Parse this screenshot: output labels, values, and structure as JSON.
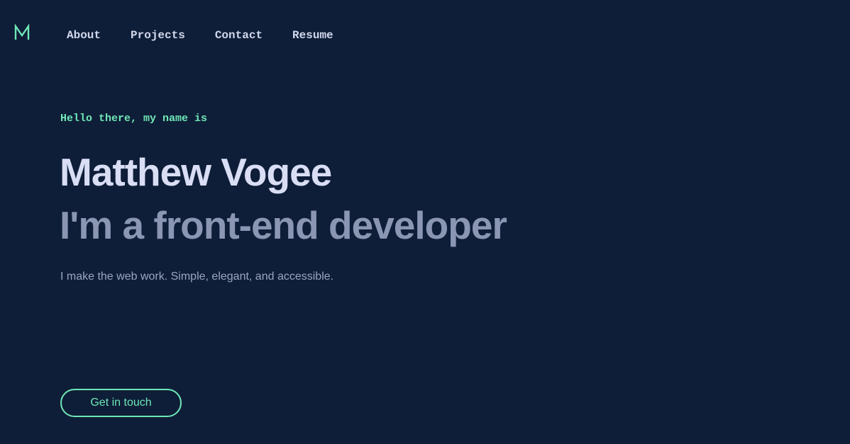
{
  "logo": {
    "icon": "m-logo-icon",
    "color": "#6ee7b7"
  },
  "nav": {
    "items": [
      {
        "label": "About"
      },
      {
        "label": "Projects"
      },
      {
        "label": "Contact"
      },
      {
        "label": "Resume"
      }
    ]
  },
  "hero": {
    "greeting": "Hello there, my name is",
    "name": "Matthew Vogee",
    "role": "I'm a front-end developer",
    "tagline": "I make the web work. Simple, elegant, and accessible.",
    "cta_label": "Get in touch"
  },
  "colors": {
    "background": "#0f1e38",
    "accent": "#6ee7b7",
    "heading": "#d9def5",
    "subheading": "#8a96b4",
    "body_text": "#9aa5c2"
  }
}
